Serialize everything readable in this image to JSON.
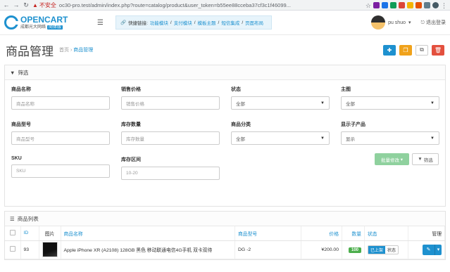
{
  "browser": {
    "warning": "不安全",
    "url": "oc30-pro.test/admin/index.php?route=catalog/product&user_token=b55ee88cceba37cf3c1f46099..."
  },
  "header": {
    "logo_title": "OPENCART",
    "logo_sub": "成都光大网络",
    "logo_badge": "简体版",
    "quick_label": "快捷链接:",
    "quick_links": [
      "功能模块",
      "支付模块",
      "模板主题",
      "短信集成",
      "页面布局"
    ],
    "user_name": "pu shuo",
    "logout": "退出登录"
  },
  "page": {
    "title": "商品管理",
    "breadcrumb_home": "首页",
    "breadcrumb_current": "商品管理"
  },
  "filter": {
    "heading": "筛选",
    "fields": {
      "name": {
        "label": "商品名称",
        "placeholder": "商品名称"
      },
      "price": {
        "label": "销售价格",
        "placeholder": "销售价格"
      },
      "status": {
        "label": "状态",
        "value": "全部"
      },
      "image": {
        "label": "主图",
        "value": "全部"
      },
      "model": {
        "label": "商品型号",
        "placeholder": "商品型号"
      },
      "stock": {
        "label": "库存数量",
        "placeholder": "库存数量"
      },
      "category": {
        "label": "商品分类",
        "value": "全部"
      },
      "subproducts": {
        "label": "显示子产品",
        "value": "显示"
      },
      "sku": {
        "label": "SKU",
        "placeholder": "SKU"
      },
      "stock_range": {
        "label": "库存区间",
        "placeholder": "10-20"
      }
    },
    "bulk_label": "批量修改",
    "filter_button": "筛选"
  },
  "list": {
    "heading": "商品列表",
    "columns": {
      "id": "ID",
      "image": "图片",
      "name": "商品名称",
      "model": "商品型号",
      "price": "价格",
      "qty": "数量",
      "status": "状态",
      "action": "管理"
    },
    "rows": [
      {
        "id": "93",
        "name": "Apple iPhone XR (A2108) 128GB 黑色 移动联通电信4G手机 双卡双待",
        "model": "DG -2",
        "price": "¥200.00",
        "qty": "100",
        "status_on": "已上架",
        "status_off": "状态"
      }
    ]
  },
  "colors": {
    "accent": "#1e91cf",
    "success": "#4cae4c",
    "warning": "#f0a21b",
    "danger": "#e3503e"
  }
}
